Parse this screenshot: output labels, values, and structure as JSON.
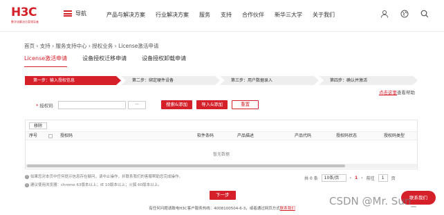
{
  "header": {
    "logo": "H3C",
    "logo_sub": "数字化解决方案领导者",
    "nav_label": "导航",
    "menu": [
      "产品与解决方案",
      "行业解决方案",
      "服务",
      "支持",
      "合作伙伴",
      "新华三大学",
      "关于我们"
    ],
    "icons": [
      "user-icon",
      "globe-icon",
      "search-icon"
    ]
  },
  "breadcrumb": "首页 › 支持 › 服务支持中心 › 授权业务 › License激活申请",
  "tabs": [
    {
      "label": "License激活申请",
      "active": true
    },
    {
      "label": "设备授权迁移申请",
      "active": false
    },
    {
      "label": "设备授权卸载申请",
      "active": false
    }
  ],
  "steps": [
    "第一步：输入授权信息",
    "第二步：绑定硬件设备",
    "第三步：用户数据录入",
    "第四步：确认并激活"
  ],
  "help": {
    "link": "点击这里",
    "text": "查看帮助"
  },
  "form": {
    "label": "授权码",
    "required_mark": "*",
    "dots": "···",
    "btn_search_add": "搜索&添加",
    "btn_import_add": "导入&添加",
    "btn_reset": "重置"
  },
  "table": {
    "delete_btn": "移除",
    "columns": [
      "序号",
      "授权码",
      "软件条码",
      "产品描述",
      "产品代码",
      "授权码状态",
      "授权码类型"
    ],
    "empty_text": "暂无数据"
  },
  "notes": [
    "如果您对本页中任何提示信息存在疑问，请中止操作，并联系我们的客服帮助您完成操作。",
    "建议使用浏览器：chrome 63版本以上；IE 10版本以上；火狐 60版本以上。"
  ],
  "pager": {
    "total": "共 0 条",
    "page_size": "10条/页",
    "prev": "‹",
    "current": "1",
    "next": "›",
    "goto_label": "前往",
    "goto_value": "1",
    "page_unit": "页"
  },
  "next_button": "下一步",
  "footer": {
    "text": "有任何问题请致电H3C客户服务热线：4008100504-6-3，或者通过网页方式",
    "link": "联系我们"
  },
  "float_button": "联系我们",
  "watermark": "CSDN @Mr. Sun_",
  "colors": {
    "brand": "#d5202a"
  }
}
